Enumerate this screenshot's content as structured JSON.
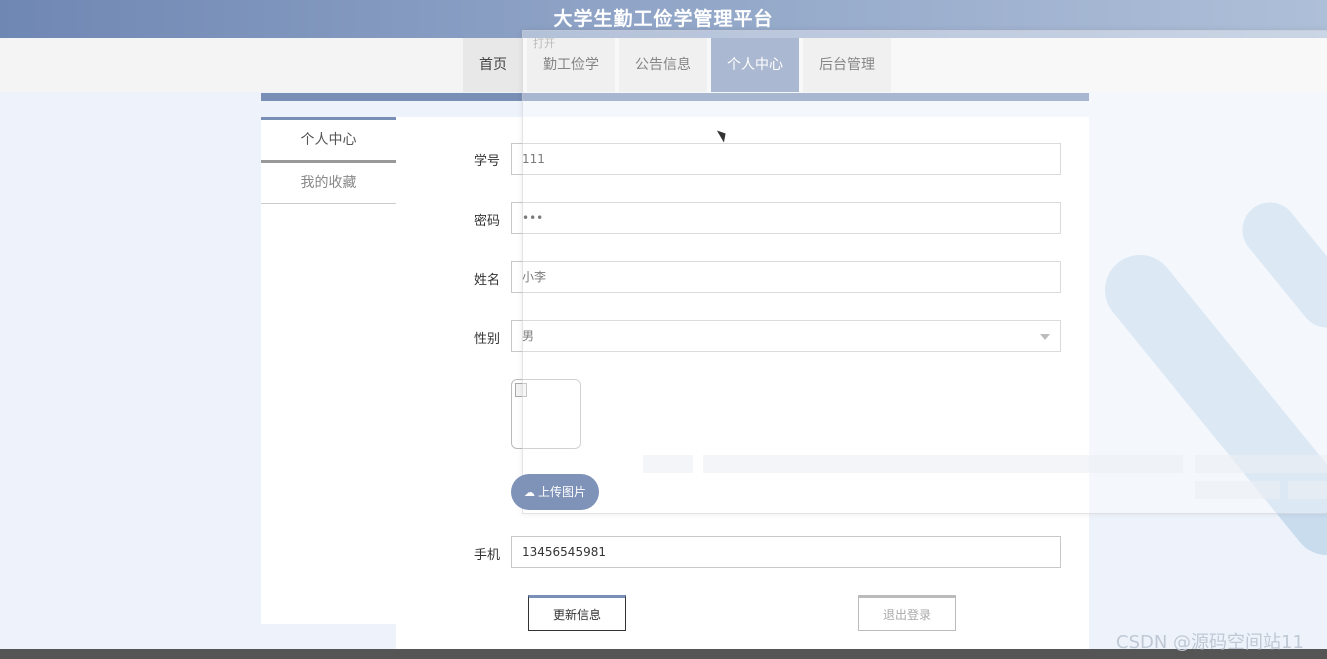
{
  "header": {
    "title": "大学生勤工俭学管理平台"
  },
  "nav": {
    "items": [
      {
        "label": "首页",
        "active": false
      },
      {
        "label": "勤工俭学",
        "active": false
      },
      {
        "label": "公告信息",
        "active": false
      },
      {
        "label": "个人中心",
        "active": true
      },
      {
        "label": "后台管理",
        "active": false
      }
    ]
  },
  "side_menu": {
    "items": [
      {
        "label": "个人中心",
        "active": true
      },
      {
        "label": "我的收藏",
        "active": false
      }
    ]
  },
  "form": {
    "student_id": {
      "label": "学号",
      "value": "111"
    },
    "password": {
      "label": "密码",
      "value": "•••"
    },
    "name": {
      "label": "姓名",
      "value": "小李"
    },
    "gender": {
      "label": "性别",
      "value": "男"
    },
    "upload_label": "上传图片",
    "phone": {
      "label": "手机",
      "value": "13456545981"
    }
  },
  "buttons": {
    "update": "更新信息",
    "logout": "退出登录"
  },
  "overlay": {
    "title": "打开"
  },
  "watermark": "CSDN @源码空间站11",
  "colors": {
    "accent": "#7f93b8",
    "header": "#6f87b3"
  }
}
